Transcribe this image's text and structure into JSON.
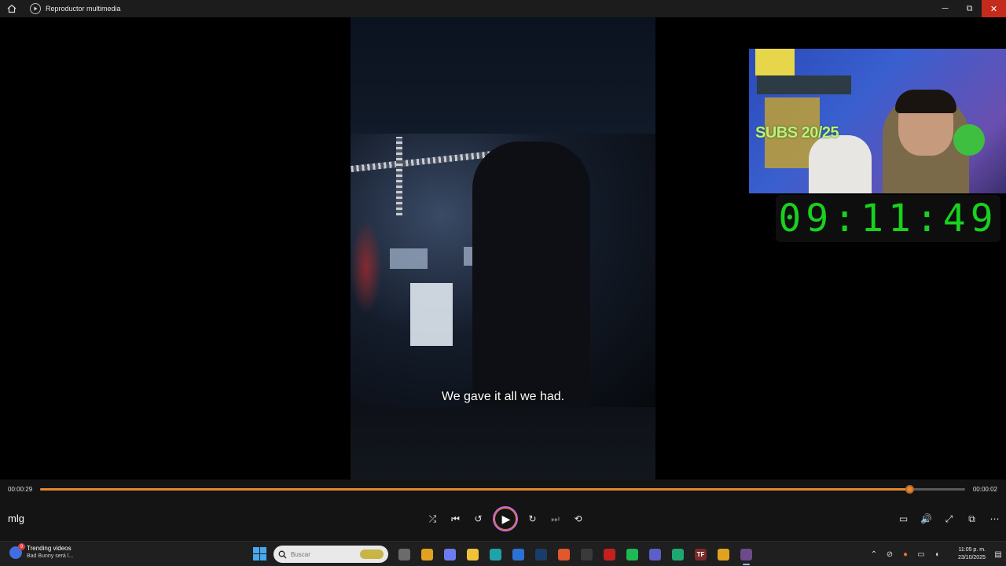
{
  "window": {
    "title": "Reproductor multimedia",
    "minimize_glyph": "─",
    "maximize_glyph": "⧉",
    "close_glyph": "✕"
  },
  "video": {
    "subtitle": "We gave it all we had."
  },
  "overlay": {
    "subs_label": "SUBS 20/25",
    "timer": "09:11:49"
  },
  "player": {
    "elapsed": "00:00:29",
    "remaining": "00:00:02",
    "progress_fraction": 0.94,
    "media_title": "mlg",
    "accent_color": "#e4862f",
    "controls": [
      {
        "name": "shuffle-icon",
        "glyph": "⤮",
        "disabled": false
      },
      {
        "name": "previous-icon",
        "glyph": "⏮",
        "disabled": false
      },
      {
        "name": "rewind-10-icon",
        "glyph": "↺",
        "disabled": false
      },
      {
        "name": "play-icon",
        "glyph": "▶",
        "disabled": false
      },
      {
        "name": "forward-30-icon",
        "glyph": "↻",
        "disabled": false
      },
      {
        "name": "next-icon",
        "glyph": "⏭",
        "disabled": true
      },
      {
        "name": "repeat-off-icon",
        "glyph": "⟲",
        "disabled": false
      }
    ],
    "right_controls": [
      {
        "name": "subtitles-icon",
        "glyph": "▭"
      },
      {
        "name": "volume-icon",
        "glyph": "🔊"
      },
      {
        "name": "fullscreen-icon",
        "glyph": "⤢"
      },
      {
        "name": "miniplayer-icon",
        "glyph": "⧉"
      },
      {
        "name": "more-options-icon",
        "glyph": "⋯"
      }
    ]
  },
  "taskbar": {
    "widget_title": "Trending videos",
    "widget_subtitle": "Bad Bunny será l...",
    "widget_badge": "9",
    "search_placeholder": "Buscar",
    "apps": [
      {
        "name": "file-viewer-icon",
        "color": "#6b6b6b",
        "label": ""
      },
      {
        "name": "chrome-icon",
        "color": "#e0a21f",
        "label": ""
      },
      {
        "name": "copilot-icon",
        "color": "#6a7cf0",
        "label": ""
      },
      {
        "name": "file-explorer-icon",
        "color": "#f0c23a",
        "label": ""
      },
      {
        "name": "edge-icon",
        "color": "#1fa3a8",
        "label": ""
      },
      {
        "name": "outlook-icon",
        "color": "#2a72d4",
        "label": ""
      },
      {
        "name": "steam-icon",
        "color": "#1b3c68",
        "label": ""
      },
      {
        "name": "firefox-icon",
        "color": "#e2572e",
        "label": ""
      },
      {
        "name": "audio-app-icon",
        "color": "#3a3a3a",
        "label": ""
      },
      {
        "name": "red-app-icon",
        "color": "#c42020",
        "label": ""
      },
      {
        "name": "spotify-icon",
        "color": "#1db954",
        "label": ""
      },
      {
        "name": "teams-icon",
        "color": "#5b5fc7",
        "label": ""
      },
      {
        "name": "green-app-icon",
        "color": "#1ea870",
        "label": ""
      },
      {
        "name": "tf-app-icon",
        "color": "#7a2a2a",
        "label": "TF"
      },
      {
        "name": "chrome-2-icon",
        "color": "#e0a21f",
        "label": ""
      },
      {
        "name": "media-player-icon",
        "color": "#6b4b8a",
        "label": "",
        "active": true
      }
    ],
    "clock_time": "11:05 p. m.",
    "clock_date": "23/10/2025"
  }
}
